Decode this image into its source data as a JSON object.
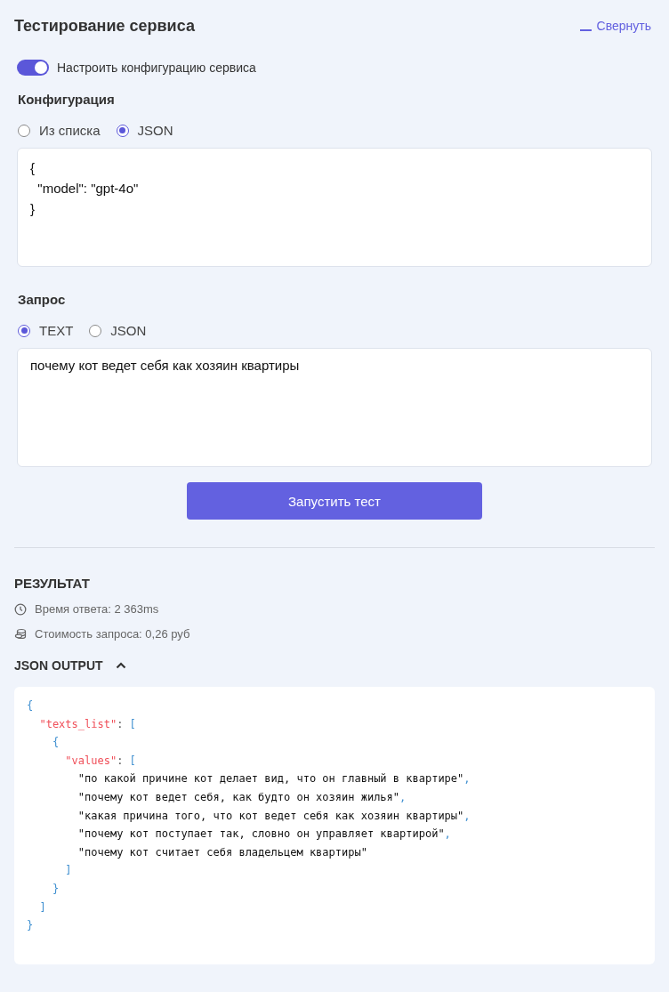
{
  "header": {
    "title": "Тестирование сервиса",
    "collapse_link": "Свернуть"
  },
  "toggle": {
    "label": "Настроить конфигурацию сервиса",
    "on": true
  },
  "configuration": {
    "title": "Конфигурация",
    "options": [
      {
        "label": "Из списка",
        "selected": false
      },
      {
        "label": "JSON",
        "selected": true
      }
    ],
    "editor_lines": [
      "{",
      "  \"model\": \"gpt-4o\"",
      "}"
    ]
  },
  "request": {
    "title": "Запрос",
    "options": [
      {
        "label": "TEXT",
        "selected": true
      },
      {
        "label": "JSON",
        "selected": false
      }
    ],
    "value": "почему кот ведет себя как хозяин квартиры"
  },
  "run_button": "Запустить тест",
  "result": {
    "title": "РЕЗУЛЬТАТ",
    "stats": [
      {
        "kind": "time",
        "text": "Время ответа: 2 363ms"
      },
      {
        "kind": "cost",
        "text": "Стоимость запроса: 0,26 руб"
      }
    ],
    "output_title": "JSON OUTPUT",
    "output_expanded": true,
    "output_lines": [
      [
        {
          "kind": "punct",
          "text": "{"
        }
      ],
      [
        {
          "kind": "key",
          "text": "  \"texts_list\""
        },
        {
          "kind": "colon",
          "text": ": "
        },
        {
          "kind": "punct",
          "text": "["
        }
      ],
      [
        {
          "kind": "punct",
          "text": "    {"
        }
      ],
      [
        {
          "kind": "key",
          "text": "      \"values\""
        },
        {
          "kind": "colon",
          "text": ": "
        },
        {
          "kind": "punct",
          "text": "["
        }
      ],
      [
        {
          "kind": "string",
          "text": "        \"по какой причине кот делает вид, что он главный в квартире\""
        },
        {
          "kind": "punct",
          "text": ","
        }
      ],
      [
        {
          "kind": "string",
          "text": "        \"почему кот ведет себя, как будто он хозяин жилья\""
        },
        {
          "kind": "punct",
          "text": ","
        }
      ],
      [
        {
          "kind": "string",
          "text": "        \"какая причина того, что кот ведет себя как хозяин квартиры\""
        },
        {
          "kind": "punct",
          "text": ","
        }
      ],
      [
        {
          "kind": "string",
          "text": "        \"почему кот поступает так, словно он управляет квартирой\""
        },
        {
          "kind": "punct",
          "text": ","
        }
      ],
      [
        {
          "kind": "string",
          "text": "        \"почему кот считает себя владельцем квартиры\""
        }
      ],
      [
        {
          "kind": "punct",
          "text": "      ]"
        }
      ],
      [
        {
          "kind": "punct",
          "text": "    }"
        }
      ],
      [
        {
          "kind": "punct",
          "text": "  ]"
        }
      ],
      [
        {
          "kind": "punct",
          "text": "}"
        }
      ]
    ]
  }
}
